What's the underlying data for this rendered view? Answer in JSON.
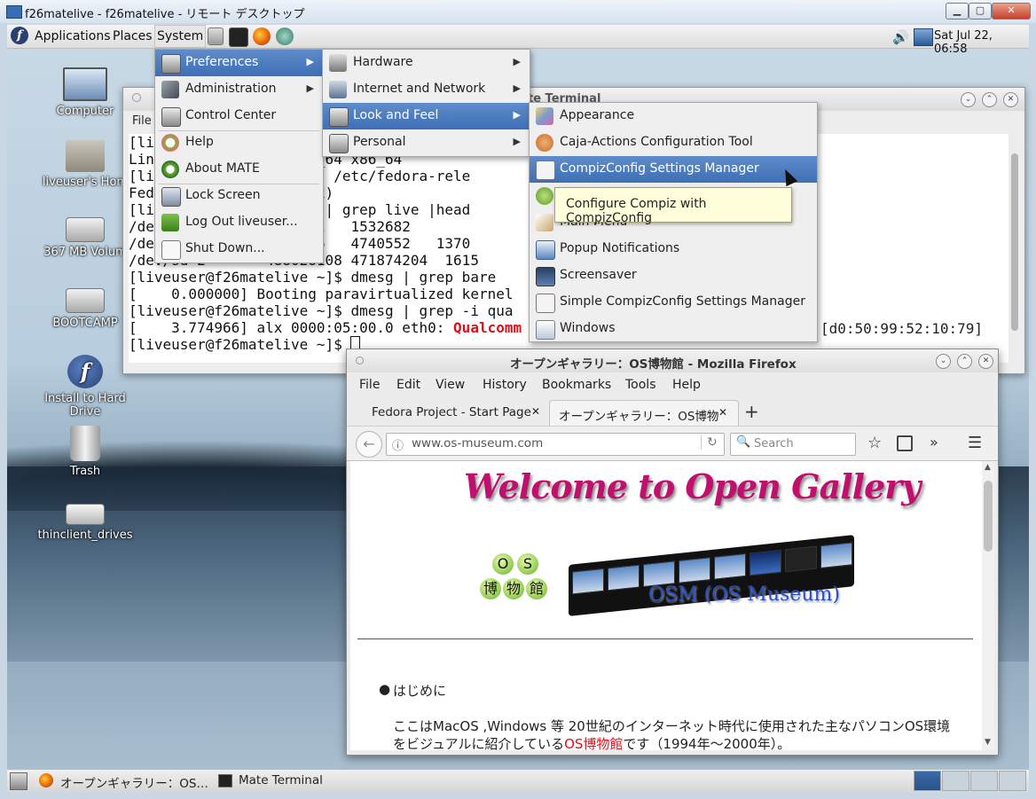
{
  "rd": {
    "title": "f26matelive - f26matelive - リモート デスクトップ"
  },
  "panel": {
    "applications": "Applications",
    "places": "Places",
    "system": "System",
    "clock": "Sat Jul 22, 06:58"
  },
  "desktop_icons": {
    "computer": "Computer",
    "home": "liveuser's Hom",
    "volume": "367 MB Volum",
    "bootcamp": "BOOTCAMP",
    "install": "Install to Hard Drive",
    "trash": "Trash",
    "thinclient": "thinclient_drives"
  },
  "terminal": {
    "title": "Mate Terminal",
    "title_visible": "te Terminal",
    "menu_file": "File",
    "lines": [
      "[li",
      "Lin                x86_64 x86_64",
      "[li             ~]$ cat /etc/fedora-rele",
      "Fed             nty Six)",
      "[li             ~]$ df | grep live |head",
      "/de             1532682   1532682",
      "/de             6126976   4740552   1370",
      "/dev/sd 2       488026108 471874204  1615                                 OTCAMP",
      "[liveuser@f26matelive ~]$ dmesg | grep bare",
      "[    0.000000] Booting paravirtualized kernel",
      "[liveuser@f26matelive ~]$ dmesg | grep -i qua",
      "[    3.774966] alx 0000:05:00.0 eth0: ",
      "[liveuser@f26matelive ~]$ "
    ],
    "qualcomm": "Qualcomm",
    "mac": "[d0:50:99:52:10:79]"
  },
  "system_menu": {
    "preferences": "Preferences",
    "administration": "Administration",
    "control_center": "Control Center",
    "help": "Help",
    "about": "About MATE",
    "lock": "Lock Screen",
    "logout": "Log Out liveuser...",
    "shutdown": "Shut Down..."
  },
  "prefs_menu": {
    "hardware": "Hardware",
    "internet": "Internet and Network",
    "look": "Look and Feel",
    "personal": "Personal"
  },
  "look_menu": {
    "appearance": "Appearance",
    "caja": "Caja-Actions Configuration Tool",
    "compiz": "CompizConfig Settings Manager",
    "main_menu": "Main Menu",
    "popup": "Popup Notifications",
    "screensaver": "Screensaver",
    "simple": "Simple CompizConfig Settings Manager",
    "windows": "Windows"
  },
  "tooltip": "Configure Compiz with CompizConfig",
  "firefox": {
    "title": "オープンギャラリー：OS博物館 - Mozilla Firefox",
    "menus": [
      "File",
      "Edit",
      "View",
      "History",
      "Bookmarks",
      "Tools",
      "Help"
    ],
    "tab1": "Fedora Project - Start Page",
    "tab2": "オープンギャラリー：OS博物",
    "url": "www.os-museum.com",
    "search_placeholder": "Search",
    "welcome": "Welcome to Open Gallery",
    "logo_os": [
      "O",
      "S"
    ],
    "logo_kanji": [
      "博",
      "物",
      "館"
    ],
    "osm_label": "OSM (OS Museum)",
    "bullet": "はじめに",
    "para1": "ここはMacOS ,Windows 等 20世紀のインターネット時代に使用された主なパソコンOS環境",
    "para2_a": "をビジュアルに紹介している",
    "para2_link": "OS博物館",
    "para2_b": "です（1994年～2000年）。"
  },
  "taskbar": {
    "firefox": "オープンギャラリー：OS…",
    "terminal": "Mate Terminal"
  },
  "colors": {
    "menu_highlight": "#4a79bd",
    "terminal_red": "#e0101a",
    "welcome_pink": "#c0106e",
    "osm_blue": "#2a4fc6"
  }
}
